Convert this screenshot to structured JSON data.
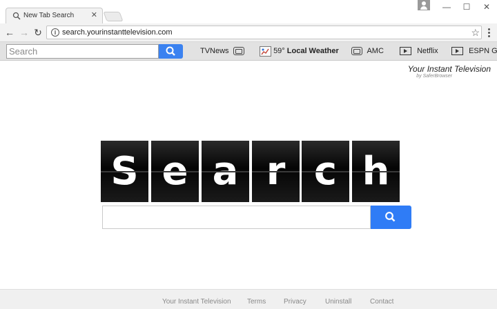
{
  "browser": {
    "tab_title": "New Tab Search",
    "tab_close": "✕",
    "url": "search.yourinstanttelevision.com",
    "win_minimize": "—",
    "win_maximize": "☐",
    "win_close": "✕",
    "back": "←",
    "forward": "→",
    "reload": "↻",
    "star": "☆",
    "info": "i"
  },
  "toolbar": {
    "search_placeholder": "Search",
    "items": [
      {
        "label": "TVNews",
        "icon": "tv-icon"
      },
      {
        "temp": "59°",
        "label": "Local Weather",
        "icon": "weather-icon"
      },
      {
        "label": "AMC",
        "icon": "tv-icon"
      },
      {
        "label": "Netflix",
        "icon": "play-icon"
      },
      {
        "label": "ESPN GO",
        "icon": "play-icon"
      }
    ]
  },
  "brand": {
    "title": "Your Instant Television",
    "subtitle": "by SaferBrowser"
  },
  "logo_letters": [
    "S",
    "e",
    "a",
    "r",
    "c",
    "h"
  ],
  "main_search": {
    "placeholder": ""
  },
  "footer": {
    "links": [
      "Your Instant Television",
      "Terms",
      "Privacy",
      "Uninstall",
      "Contact"
    ]
  },
  "colors": {
    "search_button": "#2f7cf6",
    "toolbar_bg": "#e2e2e2"
  }
}
